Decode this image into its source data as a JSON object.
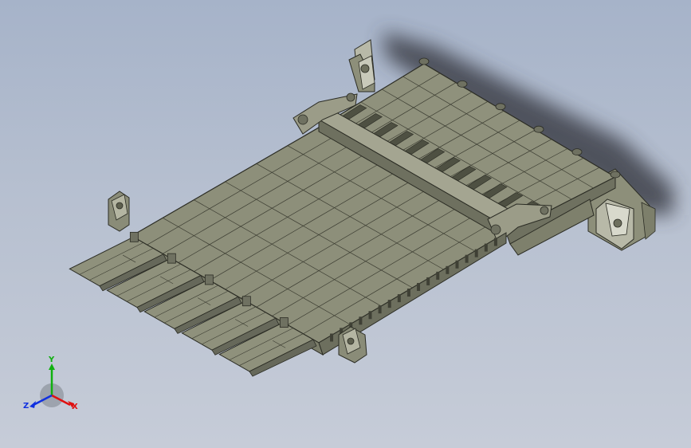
{
  "view": {
    "background_top": "#a6b3c9",
    "background_bottom": "#c6ccd8",
    "model_color": "#8d8f7a",
    "model_edge_color": "#2b2c24"
  },
  "triad": {
    "x_label": "X",
    "y_label": "Y",
    "z_label": "Z",
    "x_color": "#e01010",
    "y_color": "#10b010",
    "z_color": "#1030e0"
  }
}
